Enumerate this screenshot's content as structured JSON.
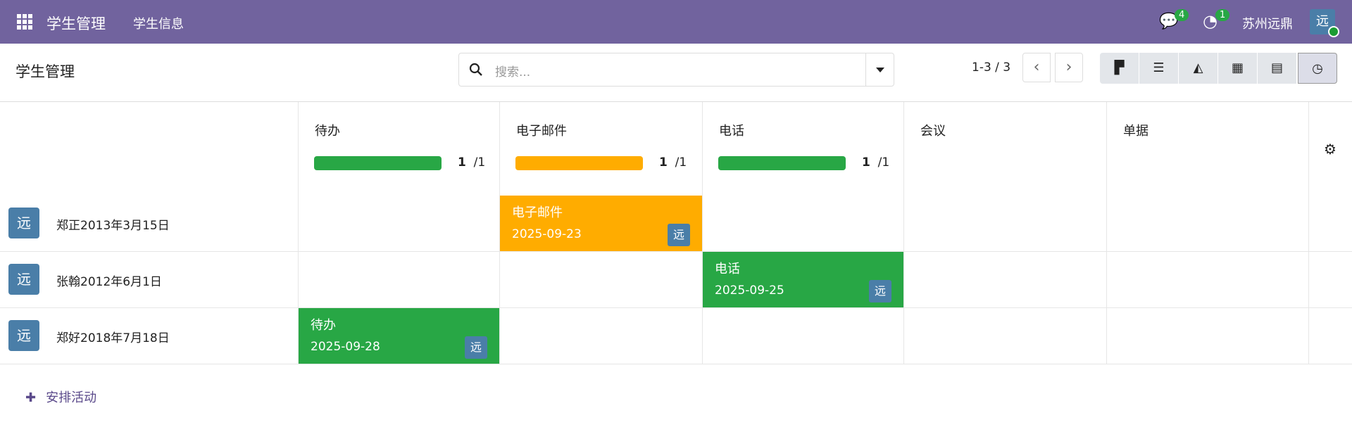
{
  "nav": {
    "brand": "学生管理",
    "menu": "学生信息",
    "messages_count": "4",
    "activities_count": "1",
    "company": "苏州远鼎",
    "avatar": "远"
  },
  "control": {
    "title": "学生管理",
    "search_placeholder": "搜索...",
    "pager": "1-3 / 3"
  },
  "columns": [
    {
      "label": "待办",
      "done": "1",
      "total": "/1",
      "progress": 1.0,
      "color": "#28a745"
    },
    {
      "label": "电子邮件",
      "done": "1",
      "total": "/1",
      "progress": 1.0,
      "color": "#ffac00"
    },
    {
      "label": "电话",
      "done": "1",
      "total": "/1",
      "progress": 1.0,
      "color": "#28a745"
    },
    {
      "label": "会议"
    },
    {
      "label": "单据"
    }
  ],
  "rows": [
    {
      "avatar": "远",
      "name": "郑正2013年3月15日"
    },
    {
      "avatar": "远",
      "name": "张翰2012年6月1日"
    },
    {
      "avatar": "远",
      "name": "郑好2018年7月18日"
    }
  ],
  "cards": [
    {
      "title": "电子邮件",
      "date": "2025-09-23",
      "avatar": "远",
      "color": "#ffac00"
    },
    {
      "title": "电话",
      "date": "2025-09-25",
      "avatar": "远",
      "color": "#28a745"
    },
    {
      "title": "待办",
      "date": "2025-09-28",
      "avatar": "远",
      "color": "#28a745"
    }
  ],
  "footer": {
    "schedule": "安排活动"
  }
}
